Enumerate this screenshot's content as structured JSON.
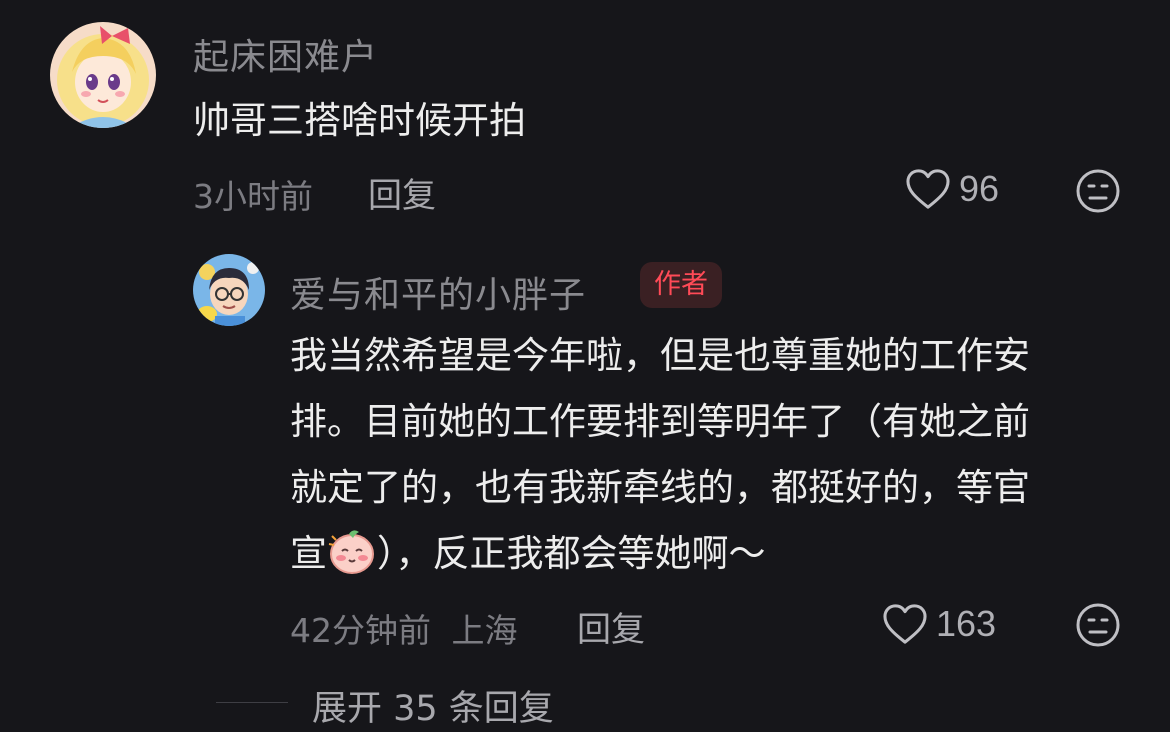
{
  "comment": {
    "username": "起床困难户",
    "text": "帅哥三搭啥时候开拍",
    "time": "3小时前",
    "reply_label": "回复",
    "like_count": "96"
  },
  "reply": {
    "username": "爱与和平的小胖子",
    "badge": "作者",
    "lines": [
      "我当然希望是今年啦，但是也尊重她的工作安",
      "排。目前她的工作要排到等明年了（有她之前",
      "就定了的，也有我新牵线的，都挺好的，等官"
    ],
    "line4_prefix": "宣",
    "line4_suffix": "），反正我都会等她啊～",
    "time": "42分钟前",
    "location": "上海",
    "reply_label": "回复",
    "like_count": "163"
  },
  "expand": {
    "label": "展开 35 条回复"
  },
  "colors": {
    "background": "#16161a",
    "badge_text": "#ff4a57",
    "badge_bg": "#3a2023"
  },
  "icons": {
    "like": "heart-outline-icon",
    "dislike": "neutral-face-icon",
    "emoji": "blushing-face-emoji"
  }
}
